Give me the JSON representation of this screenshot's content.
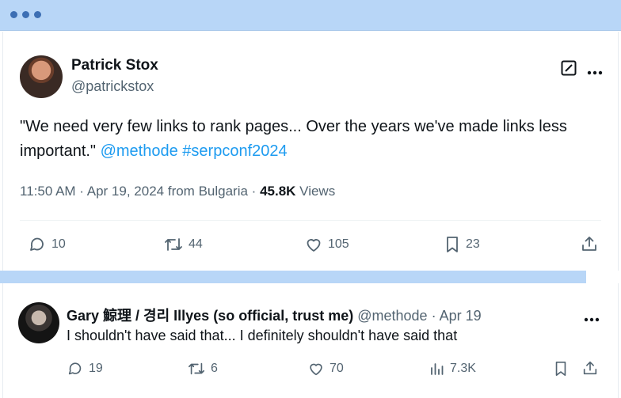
{
  "tweet": {
    "author_name": "Patrick Stox",
    "author_handle": "@patrickstox",
    "text_plain": "\"We need very few links to rank pages... Over the years we've made links less important.\"",
    "mention": "@methode",
    "hashtag": "#serpconf2024",
    "time": "11:50 AM",
    "date": "Apr 19, 2024",
    "location": "from Bulgaria",
    "views_count": "45.8K",
    "views_label": "Views",
    "replies": "10",
    "retweets": "44",
    "likes": "105",
    "bookmarks": "23"
  },
  "reply": {
    "author_name": "Gary 鯨理 / 경리 Illyes (so official, trust me)",
    "author_handle": "@methode",
    "date": "Apr 19",
    "text": "I shouldn't have said that... I definitely shouldn't have said that",
    "replies": "19",
    "retweets": "6",
    "likes": "70",
    "views": "7.3K"
  },
  "colors": {
    "accent": "#1d9bf0",
    "browser_bar": "#b8d6f7",
    "muted_text": "#536471"
  },
  "icons": [
    "window-dots-icon",
    "edit-icon",
    "more-icon",
    "reply-icon",
    "retweet-icon",
    "like-icon",
    "bookmark-icon",
    "share-icon",
    "views-icon"
  ]
}
